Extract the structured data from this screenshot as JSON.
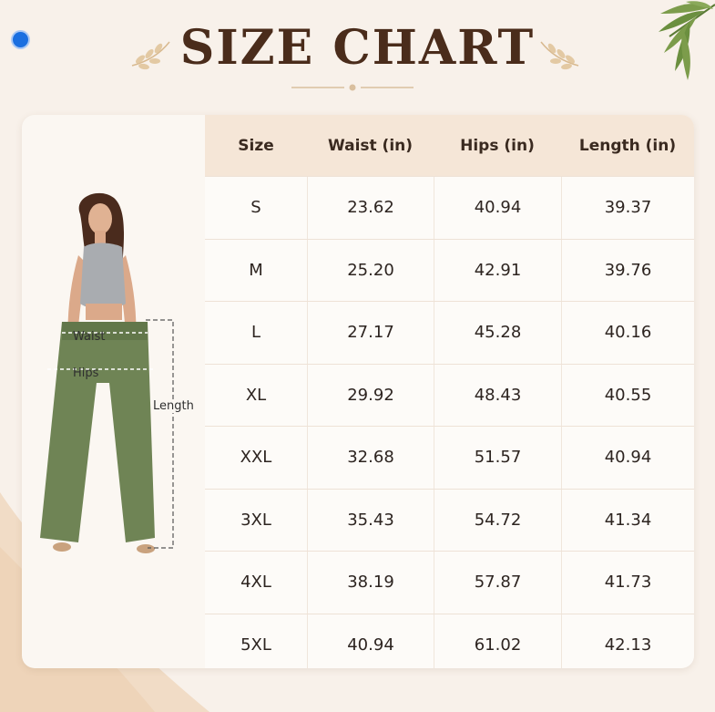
{
  "header": {
    "title": "SIZE CHART"
  },
  "figure": {
    "waist_label": "Waist",
    "hips_label": "Hips",
    "length_label": "Length"
  },
  "table": {
    "headers": [
      "Size",
      "Waist (in)",
      "Hips (in)",
      "Length (in)"
    ],
    "rows": [
      [
        "S",
        "23.62",
        "40.94",
        "39.37"
      ],
      [
        "M",
        "25.20",
        "42.91",
        "39.76"
      ],
      [
        "L",
        "27.17",
        "45.28",
        "40.16"
      ],
      [
        "XL",
        "29.92",
        "48.43",
        "40.55"
      ],
      [
        "XXL",
        "32.68",
        "51.57",
        "40.94"
      ],
      [
        "3XL",
        "35.43",
        "54.72",
        "41.34"
      ],
      [
        "4XL",
        "38.19",
        "57.87",
        "41.73"
      ],
      [
        "5XL",
        "40.94",
        "61.02",
        "42.13"
      ]
    ]
  },
  "colors": {
    "background": "#f8f1ea",
    "title": "#4a2c1b",
    "header_row": "#f5e6d7",
    "pants": "#6f8455",
    "leaf": "#6b8f3f",
    "indicator_dot": "#1b6fe0"
  }
}
